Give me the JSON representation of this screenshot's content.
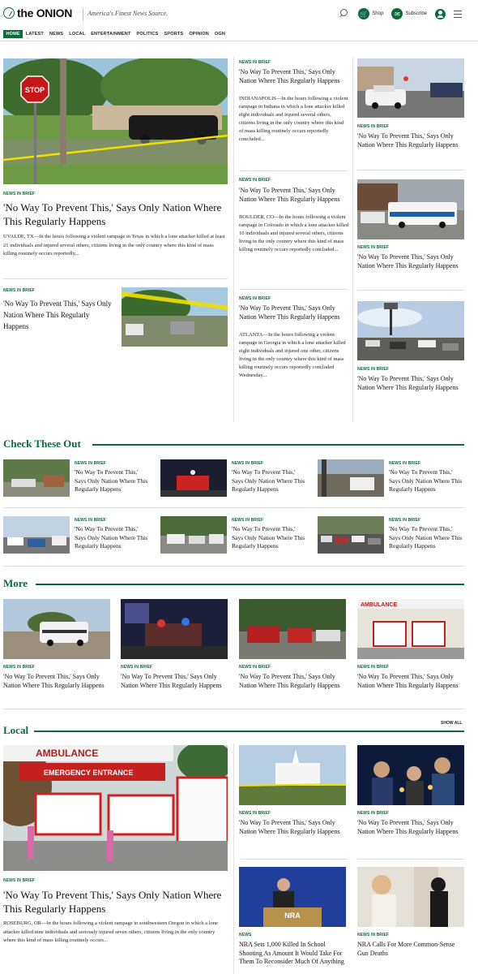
{
  "header": {
    "logo_text": "the ONION",
    "tagline": "America's Finest News Source.",
    "shop_label": "Shop",
    "subscribe_label": "Subscribe"
  },
  "nav": [
    "HOME",
    "LATEST",
    "NEWS",
    "LOCAL",
    "ENTERTAINMENT",
    "POLITICS",
    "SPORTS",
    "OPINION",
    "OGN"
  ],
  "kicker": "NEWS IN BRIEF",
  "headline": "'No Way To Prevent This,' Says Only Nation Where This Regularly Happens",
  "top": {
    "lead_body": "UVALDE, TX—In the hours following a violent rampage in Texas in which a lone attacker killed at least 21 individuals and injured several others, citizens living in the only country where this kind of mass killing routinely occurs reportedly...",
    "mid": [
      {
        "body": "INDIANAPOLIS—In the hours following a violent rampage in Indiana in which a lone attacker killed eight individuals and injured several others, citizens living in the only country where this kind of mass killing routinely occurs reportedly concluded..."
      },
      {
        "body": "BOULDER, CO—In the hours following a violent rampage in Colorado in which a lone attacker killed 10 individuals and injured several others, citizens living in the only country where this kind of mass killing routinely occurs reportedly concluded..."
      },
      {
        "body": "ATLANTA—In the hours following a violent rampage in Georgia in which a lone attacker killed eight individuals and injured one other, citizens living in the only country where this kind of mass killing routinely occurs reportedly concluded Wednesday..."
      }
    ]
  },
  "sections": {
    "check": "Check These Out",
    "more": "More",
    "local": "Local",
    "show_all": "SHOW ALL"
  },
  "local": {
    "lead_body": "ROSEBURG, OR—In the hours following a violent rampage in southwestern Oregon in which a lone attacker killed nine individuals and seriously injured seven others, citizens living in the only country where this kind of mass killing routinely occurs...",
    "nra_kicker": "NEWS",
    "nra_headline": "NRA Sets 1,000 Killed In School Shooting As Amount It Would Take For Them To Reconsider Much Of Anything",
    "gun_headline": "NRA Calls For More Common-Sense Gun Deaths",
    "ambulance_sign": "AMBULANCE",
    "emergency_sign": "EMERGENCY ENTRANCE",
    "nra_podium": "NRA",
    "stop_sign": "STOP"
  },
  "icons": [
    "search-icon",
    "cart-icon",
    "subscribe-icon",
    "user-icon",
    "menu-icon"
  ],
  "colors": {
    "brand": "#0b6b3a"
  }
}
